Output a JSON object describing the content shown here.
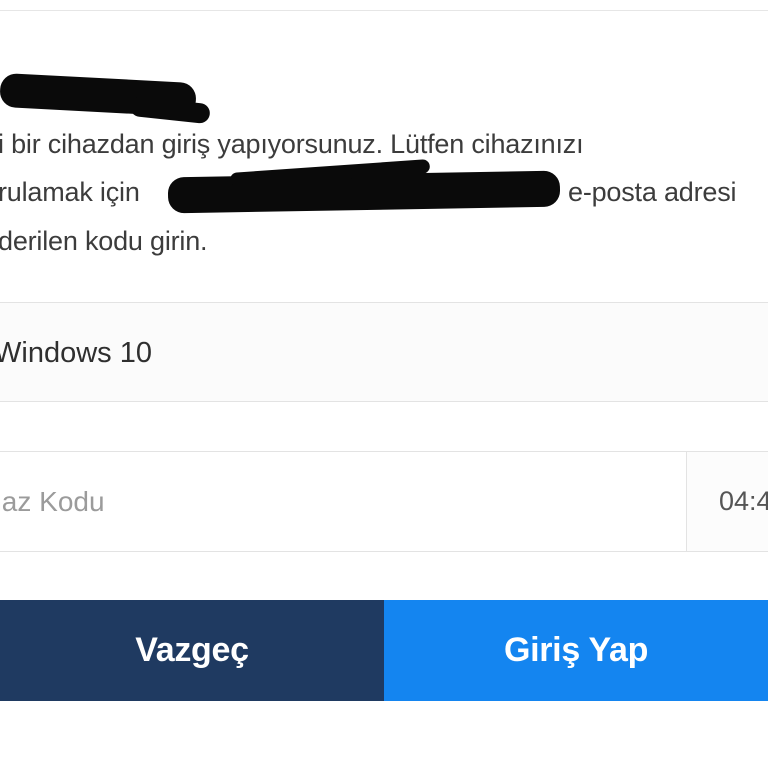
{
  "message": {
    "line1": "i bir cihazdan giriş yapıyorsunuz. Lütfen cihazınızı",
    "line2_prefix": "rulamak için",
    "line2_suffix": "e-posta adresi",
    "line3": "derilen kodu girin."
  },
  "device": {
    "name": "Windows 10"
  },
  "code": {
    "placeholder": "ihaz Kodu",
    "value": ""
  },
  "timer": {
    "text": "04:4"
  },
  "buttons": {
    "cancel_label": "Vazgeç",
    "login_label": "Giriş Yap"
  },
  "colors": {
    "cancel_bg": "#1f3a61",
    "login_bg": "#1485f0"
  }
}
